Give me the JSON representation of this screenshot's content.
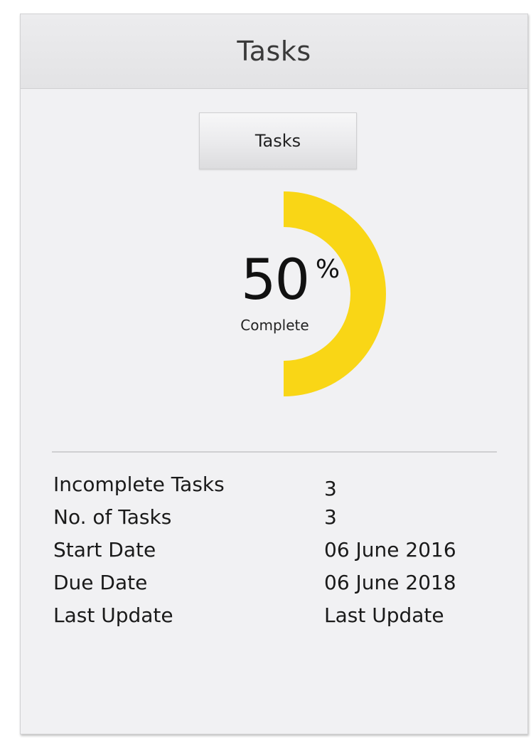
{
  "header": {
    "title": "Tasks"
  },
  "tab": {
    "label": "Tasks"
  },
  "progress": {
    "percent": 50,
    "value_text": "50",
    "unit": "%",
    "label": "Complete",
    "color": "#f9d616",
    "track_color": "#f1f1f3"
  },
  "details": [
    {
      "label": "Incomplete Tasks",
      "value": "3"
    },
    {
      "label": "No. of Tasks",
      "value": "3"
    },
    {
      "label": "Start Date",
      "value": "06 June 2016"
    },
    {
      "label": "Due Date",
      "value": "06 June 2018"
    },
    {
      "label": "Last Update",
      "value": "Last Update"
    }
  ]
}
